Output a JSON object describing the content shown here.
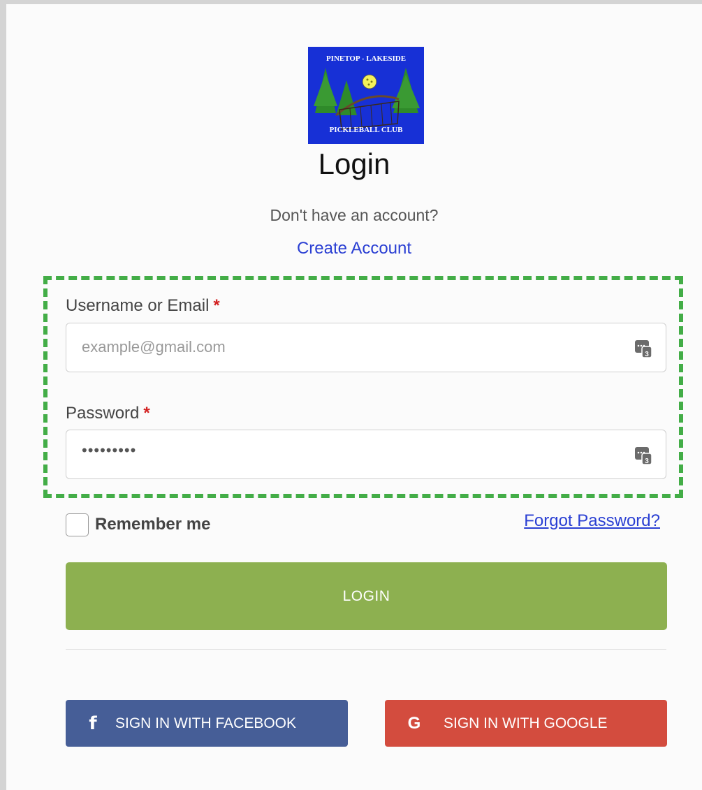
{
  "logo": {
    "top_text": "PINETOP - LAKESIDE",
    "bottom_text": "PICKLEBALL CLUB",
    "bg_color": "#1730d6"
  },
  "heading": {
    "title": "Login",
    "subtitle": "Don't have an account?",
    "create_account": "Create Account"
  },
  "form": {
    "username": {
      "label": "Username or Email",
      "required_mark": "*",
      "placeholder": "example@gmail.com",
      "value": ""
    },
    "password": {
      "label": "Password",
      "required_mark": "*",
      "masked_value": "•••••••••"
    },
    "remember_me": "Remember me",
    "remember_checked": false,
    "forgot_password": "Forgot Password?",
    "login_button": "LOGIN",
    "highlight_color": "#43ad47"
  },
  "social": {
    "facebook": {
      "icon": "facebook-f-icon",
      "label": "SIGN IN WITH FACEBOOK",
      "color": "#465e97"
    },
    "google": {
      "icon": "google-g-icon",
      "label": "SIGN IN WITH GOOGLE",
      "color": "#d34c3e"
    }
  }
}
